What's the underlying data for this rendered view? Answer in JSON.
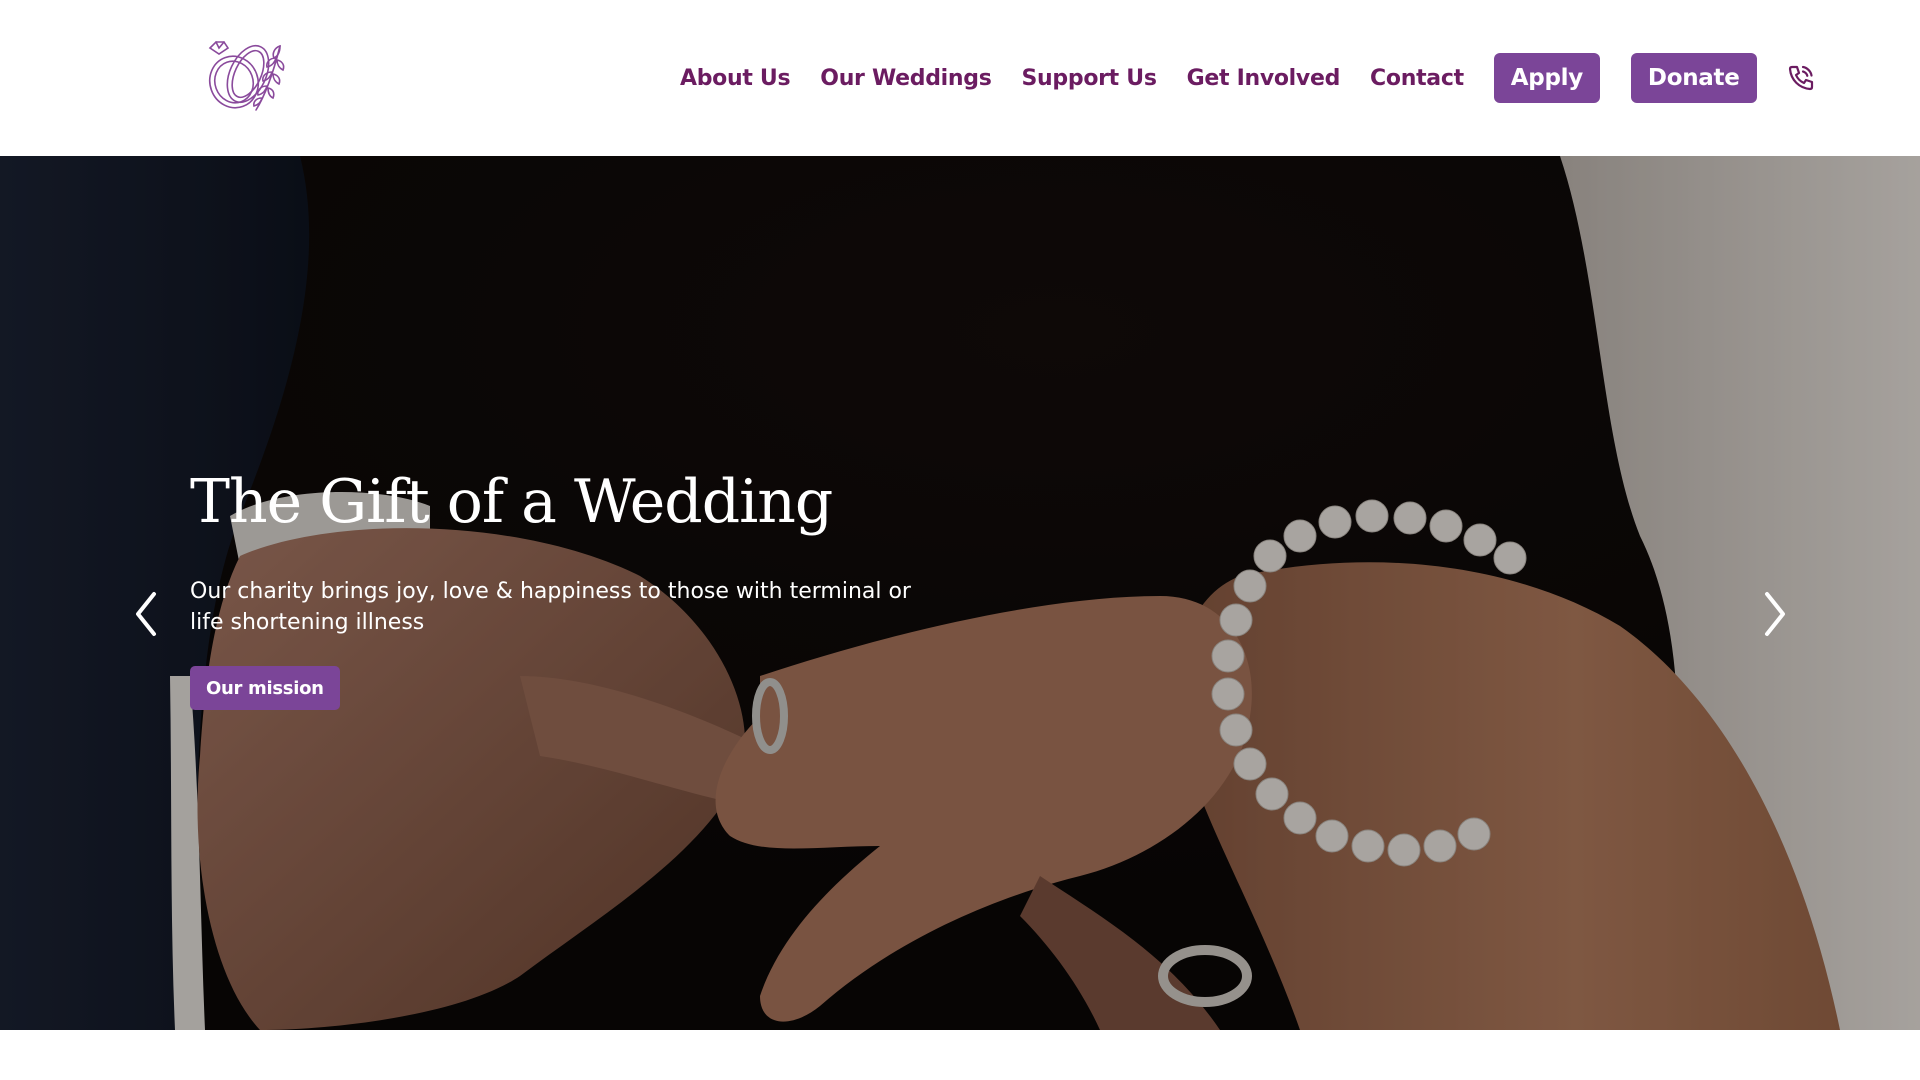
{
  "header": {
    "logo_icon": "wedding-rings-logo",
    "nav": {
      "items": [
        {
          "label": "About Us"
        },
        {
          "label": "Our Weddings"
        },
        {
          "label": "Support Us"
        },
        {
          "label": "Get Involved"
        },
        {
          "label": "Contact"
        }
      ],
      "apply_label": "Apply",
      "donate_label": "Donate",
      "phone_icon": "phone-icon"
    }
  },
  "hero": {
    "title": "The Gift of a Wedding",
    "subtitle": "Our charity brings joy, love & happiness to those with terminal or life shortening illness",
    "cta_label": "Our mission",
    "prev_icon": "chevron-left-icon",
    "next_icon": "chevron-right-icon",
    "image_description_icon": "hands-ring-photo"
  },
  "colors": {
    "brand_purple": "#7b4598",
    "nav_text": "#6b1c61",
    "hero_text": "#ffffff"
  }
}
